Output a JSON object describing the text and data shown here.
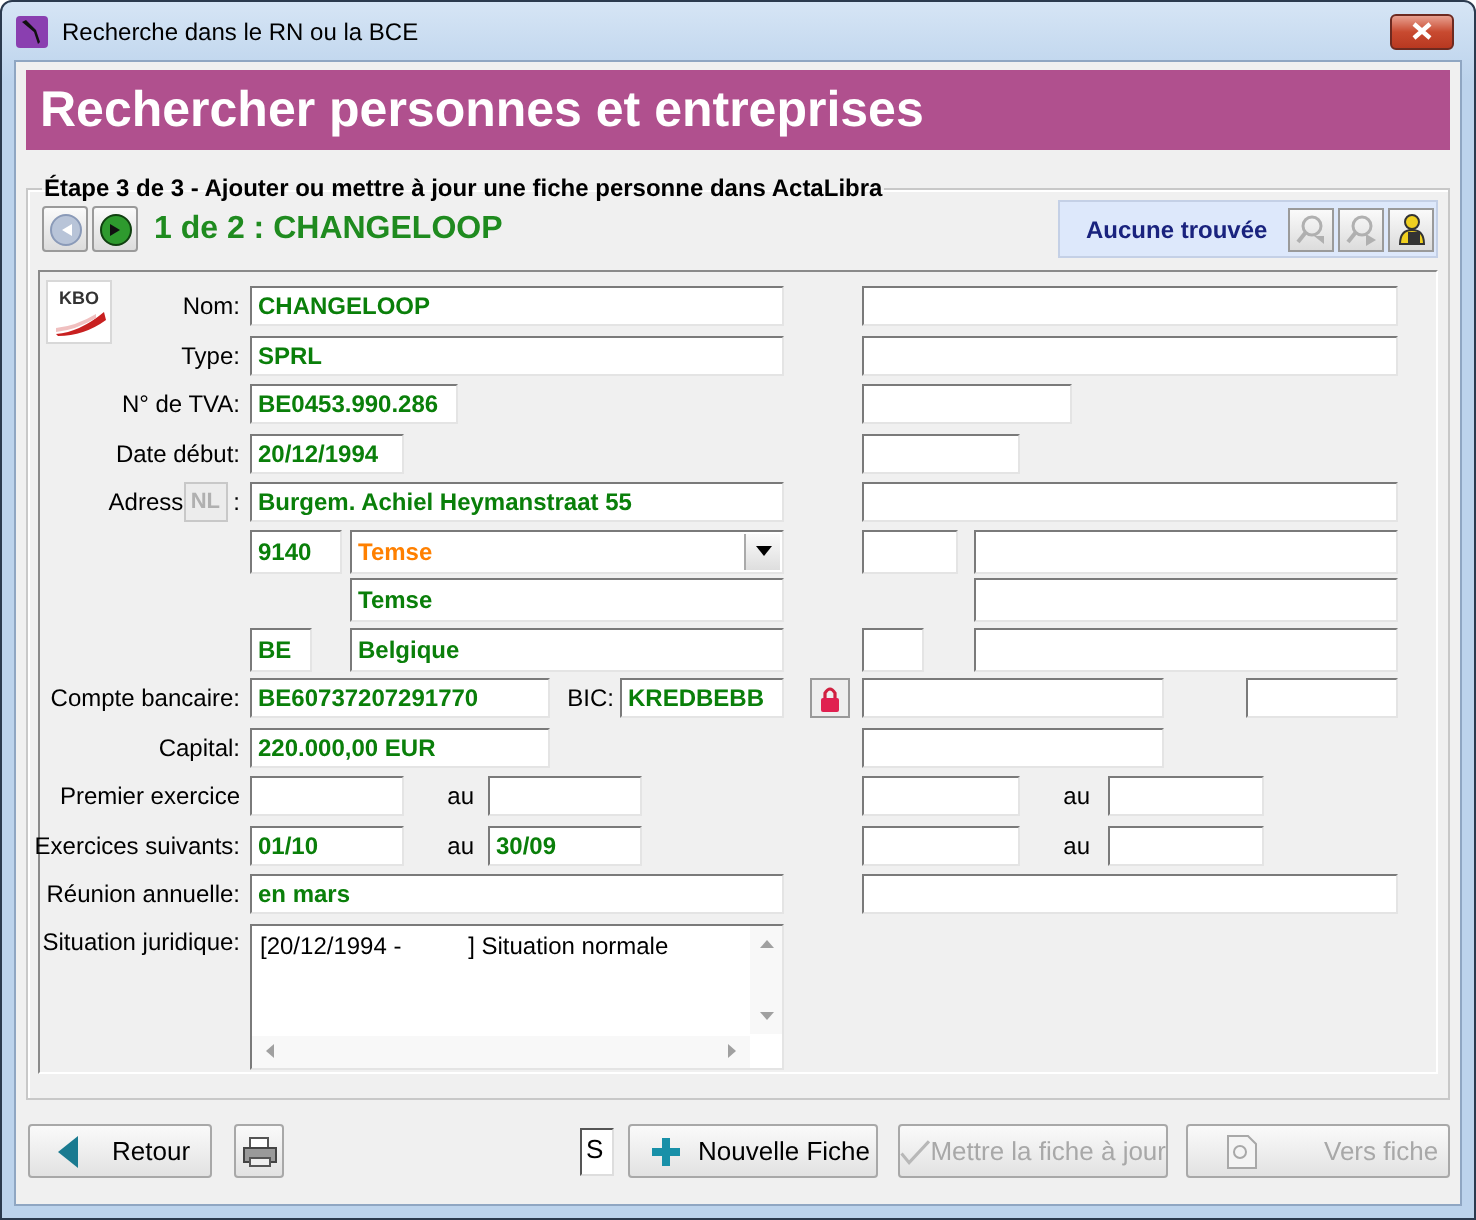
{
  "window": {
    "title": "Recherche dans le RN ou la BCE"
  },
  "banner": {
    "title": "Rechercher personnes et entreprises"
  },
  "step": {
    "legend": "Étape 3 de 3 - Ajouter ou mettre à jour une fiche personne dans ActaLibra"
  },
  "navigation": {
    "buttons": [
      {
        "kind": "previous",
        "disabled": true
      },
      {
        "kind": "next",
        "disabled": false
      }
    ],
    "record_title": "1 de 2 : CHANGELOOP"
  },
  "search_status": {
    "label": "Aucune trouvée",
    "tools": [
      {
        "kind": "search-back",
        "disabled": true
      },
      {
        "kind": "search-forward",
        "disabled": true
      },
      {
        "kind": "user-lock",
        "disabled": false
      }
    ]
  },
  "form": {
    "badge": "KBO",
    "rows": [
      {
        "kind": "text",
        "label": "Nom:",
        "value": "CHANGELOOP"
      },
      {
        "kind": "text",
        "label": "Type:",
        "value": "SPRL"
      },
      {
        "kind": "text",
        "label": "N° de TVA:",
        "value": "BE0453.990.286"
      },
      {
        "kind": "text",
        "label": "Date début:",
        "value": "20/12/1994"
      },
      {
        "kind": "address",
        "label": "Adress",
        "language": "NL",
        "label_suffix": ":",
        "value": "Burgem. Achiel Heymanstraat 55"
      },
      {
        "kind": "postal",
        "postcode": "9140",
        "city": "Temse"
      },
      {
        "kind": "city",
        "value": "Temse"
      },
      {
        "kind": "country",
        "code": "BE",
        "name": "Belgique"
      },
      {
        "kind": "bank",
        "label": "Compte bancaire:",
        "value": "BE60737207291770",
        "bic_label": "BIC:",
        "bic": "KREDBEBB"
      },
      {
        "kind": "text",
        "label": "Capital:",
        "value": "220.000,00 EUR"
      },
      {
        "kind": "period",
        "label": "Premier exercice",
        "to_label": "au",
        "second_to_label": "au"
      },
      {
        "kind": "period",
        "label": "Exercices suivants:",
        "from": "01/10",
        "to_label": "au",
        "to": "30/09",
        "second_to_label": "au"
      },
      {
        "kind": "text",
        "label": "Réunion annuelle:",
        "value": "en mars"
      },
      {
        "kind": "memo",
        "label": "Situation juridique:",
        "value": "[20/12/1994 -          ] Situation normale"
      }
    ]
  },
  "footer": {
    "buttons": [
      {
        "kind": "back",
        "label": "Retour",
        "disabled": false
      },
      {
        "kind": "print"
      },
      {
        "kind": "code",
        "value": "S"
      },
      {
        "kind": "new",
        "label": "Nouvelle Fiche",
        "disabled": false
      },
      {
        "kind": "update",
        "label": "Mettre la fiche à jour",
        "disabled": true
      },
      {
        "kind": "open",
        "label": "Vers fiche",
        "disabled": true
      }
    ]
  }
}
